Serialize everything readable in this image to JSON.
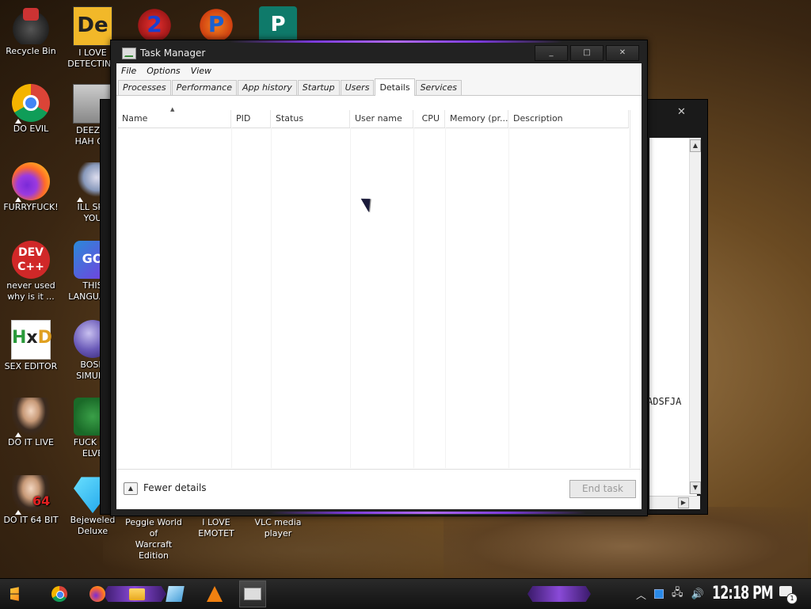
{
  "desktop_icons": {
    "recycle_bin": "Recycle Bin",
    "i_love_detecting": {
      "line1": "I LOVE",
      "line2": "DETECTING"
    },
    "do_evil": "DO EVIL",
    "deez": {
      "line1": "DEEZ N",
      "line2": "HAH GO"
    },
    "furryfuck": "FURRYFUCK!",
    "ill_spy": {
      "line1": "ILL SPY",
      "line2": "YOU"
    },
    "never_used": {
      "line1": "never used",
      "line2": "why is it ..."
    },
    "this_language": {
      "line1": "THIS",
      "line2": "LANGUAGE"
    },
    "sex_editor": "SEX EDITOR",
    "bosn": {
      "line1": "BOSN",
      "line2": "SIMULA"
    },
    "do_it_live": "DO IT LIVE",
    "fuck_so": {
      "line1": "FUCK SO",
      "line2": "ELVE"
    },
    "do_it_64": "DO IT 64 BIT",
    "bejeweled": {
      "line1": "Bejeweled",
      "line2": "Deluxe"
    },
    "peggle": {
      "line1": "Peggle World of",
      "line2": "Warcraft Edition"
    },
    "emotet": "I LOVE EMOTET",
    "vlc": {
      "line1": "VLC media",
      "line2": "player"
    },
    "icon_glyphs": {
      "de": "De",
      "dev": "DEV\nC++",
      "go": "GO",
      "hxd_h": "H",
      "hxd_x": "x",
      "hxd_d": "D",
      "two": "2",
      "p": "P",
      "pub": "P",
      "badge64": "64"
    }
  },
  "background_window": {
    "close_glyph": "✕",
    "text_fragment": "ADSFJA",
    "scroll_up": "▲",
    "scroll_down": "▼",
    "scroll_right": "▶"
  },
  "task_manager": {
    "title": "Task Manager",
    "controls": {
      "minimize": "_",
      "maximize": "□",
      "close": "✕"
    },
    "menu": {
      "file": "File",
      "options": "Options",
      "view": "View"
    },
    "tabs": [
      "Processes",
      "Performance",
      "App history",
      "Startup",
      "Users",
      "Details",
      "Services"
    ],
    "active_tab": "Details",
    "columns": {
      "name": "Name",
      "pid": "PID",
      "status": "Status",
      "user_name": "User name",
      "cpu": "CPU",
      "memory": "Memory (pr...",
      "description": "Description"
    },
    "sort_glyph": "▲",
    "footer": {
      "fewer_glyph": "▲",
      "fewer_details": "Fewer details",
      "end_task": "End task"
    }
  },
  "taskbar": {
    "clock": "12:18 PM",
    "notification_count": "1",
    "tray_up": "︿",
    "network_glyph": "🖧",
    "volume_glyph": "🔊"
  },
  "colors": {
    "accent_purple": "#8a4ad8",
    "titlebar_dark": "#222222",
    "end_task_disabled": "#9a9a9a"
  }
}
